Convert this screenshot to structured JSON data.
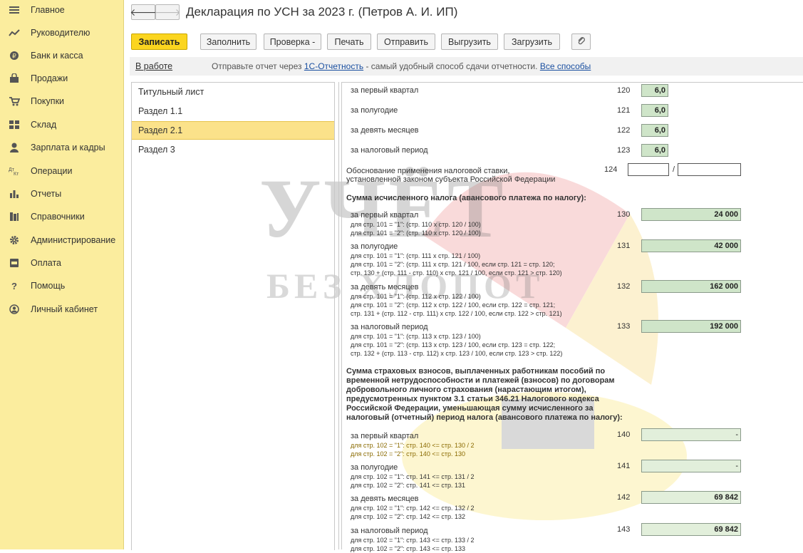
{
  "sidebar": {
    "items": [
      {
        "label": "Главное",
        "icon": "menu-lines-icon"
      },
      {
        "label": "Руководителю",
        "icon": "trend-chart-icon"
      },
      {
        "label": "Банк и касса",
        "icon": "coin-icon"
      },
      {
        "label": "Продажи",
        "icon": "bag-icon"
      },
      {
        "label": "Покупки",
        "icon": "cart-icon"
      },
      {
        "label": "Склад",
        "icon": "warehouse-grid-icon"
      },
      {
        "label": "Зарплата и кадры",
        "icon": "person-icon"
      },
      {
        "label": "Операции",
        "icon": "dt-kt-icon"
      },
      {
        "label": "Отчеты",
        "icon": "bar-chart-icon"
      },
      {
        "label": "Справочники",
        "icon": "books-icon"
      },
      {
        "label": "Администрирование",
        "icon": "gear-icon"
      },
      {
        "label": "Оплата",
        "icon": "payment-icon"
      },
      {
        "label": "Помощь",
        "icon": "question-icon"
      },
      {
        "label": "Личный кабинет",
        "icon": "account-circle-icon"
      }
    ]
  },
  "header": {
    "back_glyph": "🡐",
    "forward_glyph": "🡒",
    "title": "Декларация по УСН за 2023 г. (Петров А. И. ИП)"
  },
  "toolbar": {
    "save": "Записать",
    "fill": "Заполнить",
    "check": "Проверка -",
    "print": "Печать",
    "send": "Отправить",
    "export": "Выгрузить",
    "import": "Загрузить",
    "attach_icon": "paperclip-icon"
  },
  "infobar": {
    "status": "В работе",
    "text_before": "Отправьте отчет через",
    "link1": "1С-Отчетность",
    "text_after": "- самый удобный способ сдачи отчетности.",
    "link2": "Все способы"
  },
  "sections": [
    {
      "label": "Титульный лист"
    },
    {
      "label": "Раздел 1.1"
    },
    {
      "label": "Раздел 2.1",
      "selected": true
    },
    {
      "label": "Раздел 3"
    }
  ],
  "form": {
    "r120": {
      "label": "за первый квартал",
      "code": "120",
      "value": "6,0"
    },
    "r121": {
      "label": "за полугодие",
      "code": "121",
      "value": "6,0"
    },
    "r122": {
      "label": "за девять месяцев",
      "code": "122",
      "value": "6,0"
    },
    "r123": {
      "label": "за налоговый период",
      "code": "123",
      "value": "6,0"
    },
    "r124": {
      "line1": "Обоснование применения налоговой ставки,",
      "line2": "установленной законом субъекта Российской Федерации",
      "code": "124",
      "separator": "/"
    },
    "h130": "Сумма исчисленного налога (авансового платежа по налогу):",
    "r130": {
      "label": "за первый квартал",
      "code": "130",
      "value": "24 000",
      "subs": [
        "для стр. 101 = \"1\": (стр. 110 x стр. 120 / 100)",
        "для стр. 101 = \"2\": (стр. 110 x стр. 120 / 100)"
      ]
    },
    "r131": {
      "label": "за полугодие",
      "code": "131",
      "value": "42 000",
      "subs": [
        "для стр. 101 = \"1\": (стр. 111 x стр. 121 / 100)",
        "для стр. 101 = \"2\": (стр. 111 x стр. 121 / 100, если стр. 121 = стр. 120;",
        "стр. 130 + (стр. 111 - стр. 110) x стр. 121 / 100, если стр. 121 > стр. 120)"
      ]
    },
    "r132": {
      "label": "за девять месяцев",
      "code": "132",
      "value": "162 000",
      "subs": [
        "для стр. 101 = \"1\": (стр. 112 x стр. 122 / 100)",
        "для стр. 101 = \"2\": (стр. 112 x стр. 122 / 100, если стр. 122 = стр. 121;",
        "стр. 131 + (стр. 112 - стр. 111) x стр. 122 / 100, если стр. 122 > стр. 121)"
      ]
    },
    "r133": {
      "label": "за налоговый период",
      "code": "133",
      "value": "192 000",
      "subs": [
        "для стр. 101 = \"1\": (стр. 113 x стр. 123 / 100)",
        "для стр. 101 = \"2\": (стр. 113 x стр. 123 / 100, если стр. 123 = стр. 122;",
        "стр. 132 + (стр. 113 - стр. 112) x стр. 123 / 100, если стр. 123 > стр. 122)"
      ]
    },
    "h140": [
      "Сумма страховых взносов, выплаченных работникам пособий по",
      "временной нетрудоспособности и платежей (взносов) по договорам",
      "добровольного личного страхования (нарастающим итогом),",
      "предусмотренных пунктом 3.1 статьи 346.21 Налогового кодекса",
      "Российской Федерации, уменьшающая сумму исчисленного за",
      "налоговый (отчетный) период налога (авансового платежа по налогу):"
    ],
    "r140": {
      "label": "за первый квартал",
      "code": "140",
      "value": "-",
      "subs": [
        "для стр. 102 = \"1\": стр. 140 <= стр. 130 / 2",
        "для стр. 102 = \"2\": стр. 140 <= стр. 130"
      ]
    },
    "r141": {
      "label": "за полугодие",
      "code": "141",
      "value": "-",
      "subs": [
        "для стр. 102 = \"1\": стр. 141 <= стр. 131 / 2",
        "для стр. 102 = \"2\": стр. 141 <= стр. 131"
      ]
    },
    "r142": {
      "label": "за девять месяцев",
      "code": "142",
      "value": "69 842",
      "subs": [
        "для стр. 102 = \"1\": стр. 142 <= стр. 132 / 2",
        "для стр. 102 = \"2\": стр. 142 <= стр. 132"
      ]
    },
    "r143": {
      "label": "за налоговый период",
      "code": "143",
      "value": "69 842",
      "subs": [
        "для стр. 102 = \"1\": стр. 143 <= стр. 133 / 2",
        "для стр. 102 = \"2\": стр. 143 <= стр. 133"
      ]
    }
  },
  "watermark": {
    "line1": "УЧЁТ",
    "line2": "БЕЗ ХЛОПОТ"
  }
}
